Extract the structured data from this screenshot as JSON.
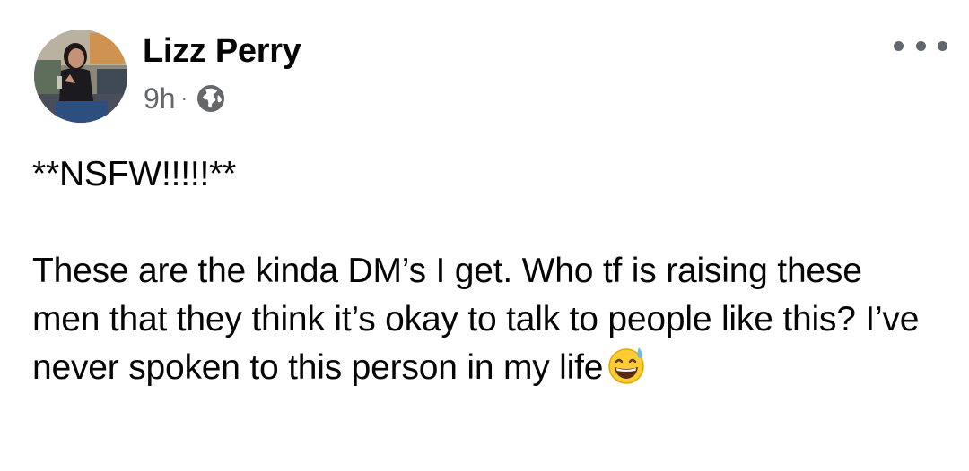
{
  "post": {
    "author": "Lizz Perry",
    "timestamp": "9h",
    "separator": "·",
    "privacy_icon": "globe-icon",
    "more_icon": "ellipsis-icon",
    "warning_line": "**NSFW!!!!!**",
    "body_text": "These are the kinda DM’s I get. Who tf is raising these men that they think it’s okay to talk to people like this? I’ve never spoken to this person in my life",
    "body_emoji": "grinning-sweat-emoji"
  },
  "colors": {
    "text_primary": "#050505",
    "text_secondary": "#65676b",
    "icon_gray": "#606770",
    "background": "#ffffff"
  }
}
